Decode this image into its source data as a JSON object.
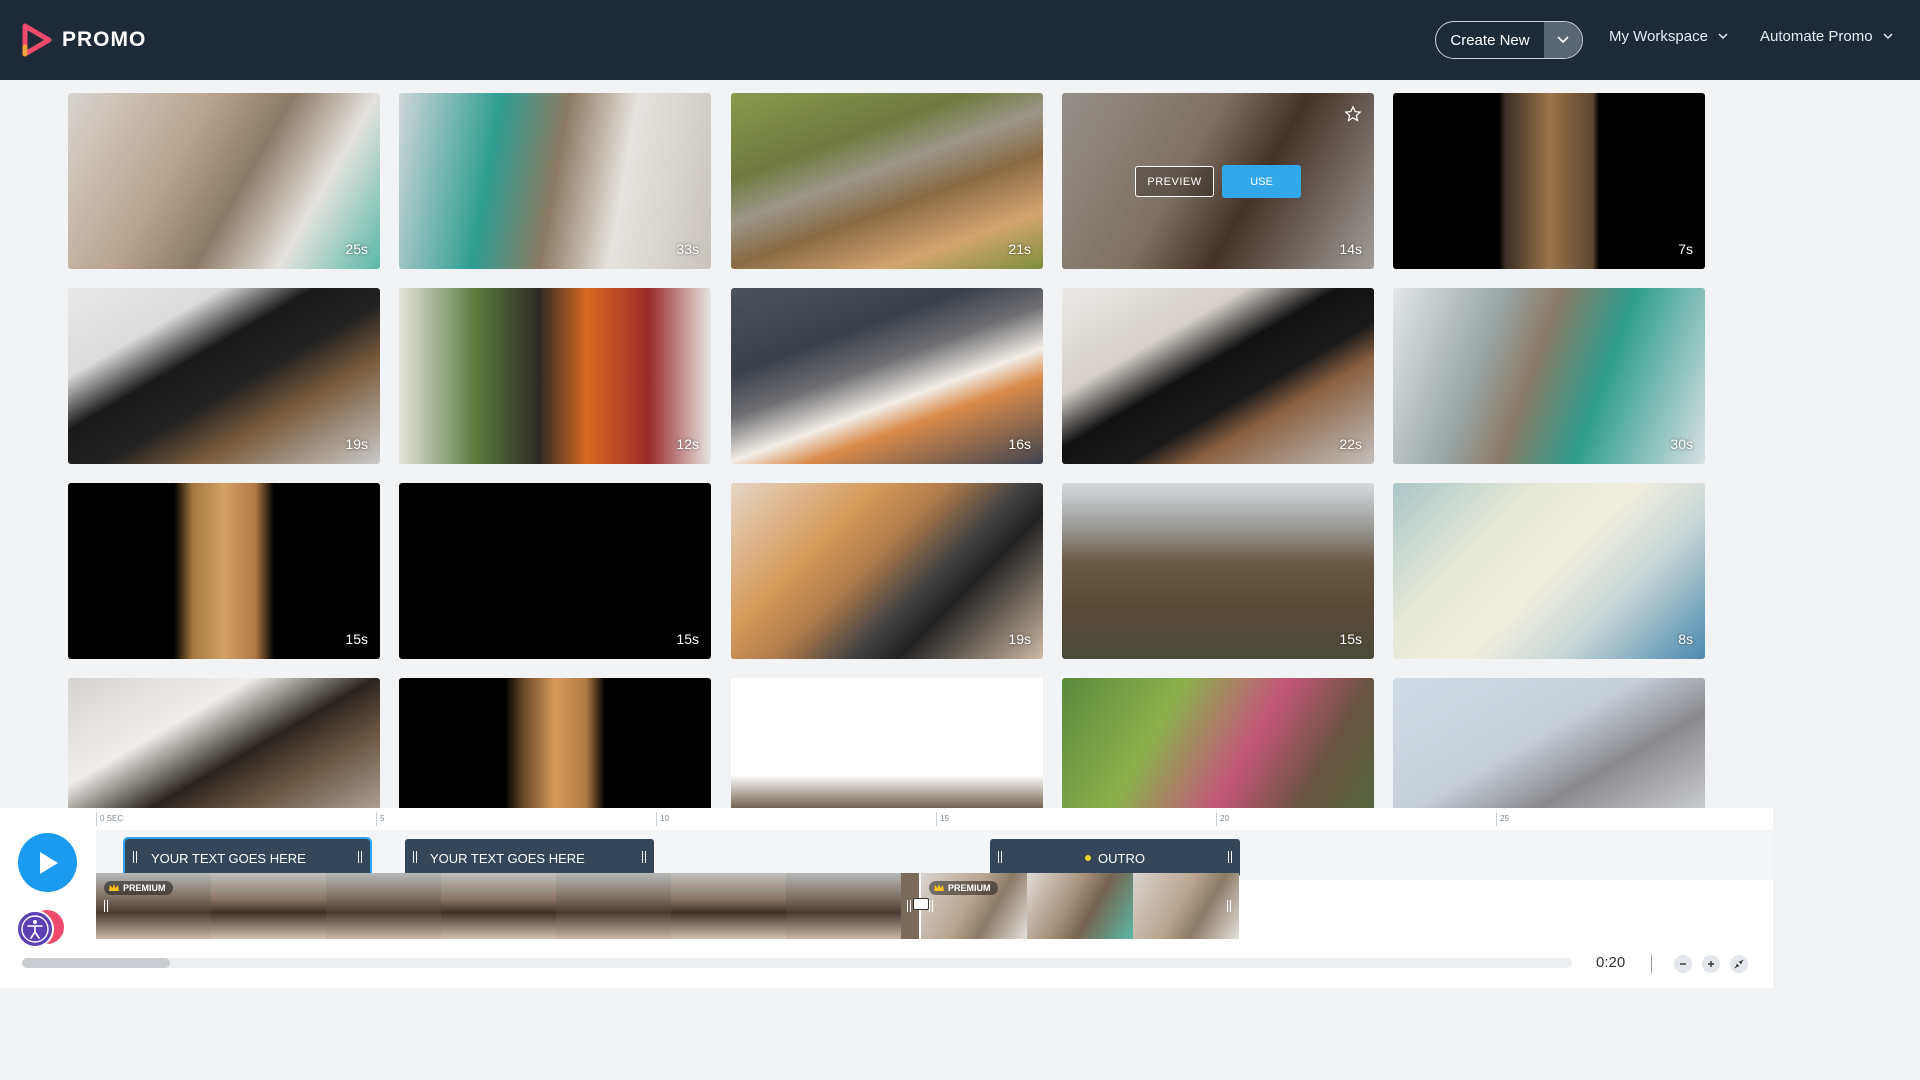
{
  "header": {
    "logo_text": "PROMO",
    "create_new_label": "Create New",
    "nav": [
      "My Workspace",
      "Automate Promo"
    ]
  },
  "colors": {
    "header_bg": "#1e2a38",
    "accent": "#1a9bf0",
    "use_button": "#32a8ea",
    "logo_accent": "#f04a6d"
  },
  "grid": {
    "preview_label": "PREVIEW",
    "use_label": "USE",
    "thumbnails": [
      {
        "duration": "25s",
        "bg": "linear-gradient(120deg,#d8d4d0 0%,#b9a48e 35%,#8b7a66 55%,#e5e2de 75%,#59b8a6 100%)"
      },
      {
        "duration": "33s",
        "bg": "linear-gradient(100deg,#cfd6d8 0%,#2e9e92 30%,#8d7a62 50%,#e6e3df 70%,#c9c3bc 100%)"
      },
      {
        "duration": "21s",
        "bg": "linear-gradient(160deg,#8a9a4c 0%,#6f7a3e 30%,#9b9687 45%,#8a6a44 60%,#d2a56e 80%,#7c8f3c 100%)"
      },
      {
        "duration": "14s",
        "bg": "linear-gradient(120deg,#c8c0b8 0%,#a89684 40%,#5a4436 60%,#d8d2cc 100%)"
      },
      {
        "duration": "7s",
        "bg": "linear-gradient(90deg,#000 0%,#000 34%,#3a2e24 36%,#9a7448 50%,#5c4632 64%,#000 66%,#000 100%)"
      },
      {
        "duration": "19s",
        "bg": "linear-gradient(150deg,#e8e8e8 0%,#dcdcdc 25%,#1a1a1a 40%,#222 55%,#7a5a3a 70%,#c9c9c9 100%)"
      },
      {
        "duration": "12s",
        "bg": "linear-gradient(90deg,#e6e4dc 0%,#5a7a3c 25%,#2e2a26 45%,#d86a20 60%,#9a2a2a 80%,#e6e6e2 100%)"
      },
      {
        "duration": "16s",
        "bg": "linear-gradient(160deg,#4b525c 0%,#3a404a 30%,#6e6e72 45%,#f2ede6 60%,#d98a4a 70%,#3e4450 100%)"
      },
      {
        "duration": "22s",
        "bg": "linear-gradient(150deg,#ece9e6 0%,#d6d0ca 30%,#111 45%,#1a1a1a 60%,#8a6040 70%,#c4c0bc 100%)"
      },
      {
        "duration": "30s",
        "bg": "linear-gradient(110deg,#e2e6e8 0%,#9aa6a6 30%,#8a7a66 45%,#2e9e8e 65%,#d8e0e2 100%)"
      },
      {
        "duration": "15s",
        "bg": "linear-gradient(90deg,#000 0%,#000 34%,#a6783e 40%,#d4a066 50%,#b07a44 60%,#000 66%,#000 100%)"
      },
      {
        "duration": "15s",
        "bg": "#000000"
      },
      {
        "duration": "19s",
        "bg": "linear-gradient(135deg,#e6d6c6 0%,#d69a5a 30%,#b07a4a 45%,#444 60%,#222 70%,#cdb9a4 100%)"
      },
      {
        "duration": "15s",
        "bg": "linear-gradient(180deg,#d6dae0 0%,#9a9a96 25%,#6a5a44 45%,#5a4a36 70%,#4a4a3a 100%)"
      },
      {
        "duration": "8s",
        "bg": "linear-gradient(135deg,#a8c6c6 0%,#e6e8d8 30%,#f2efe0 50%,#c8d6d6 70%,#4a8ab0 100%)"
      },
      {
        "duration": "",
        "bg": "linear-gradient(150deg,#d6d4d0 0%,#f0eeea 30%,#2a2420 50%,#6a5440 65%,#cfc9c2 100%)"
      },
      {
        "duration": "",
        "bg": "linear-gradient(90deg,#000 0%,#000 34%,#6a4a2a 40%,#d89a5a 50%,#b07a44 60%,#000 66%,#000 100%)"
      },
      {
        "duration": "",
        "bg": "linear-gradient(180deg,#ffffff 0%,#ffffff 55%,#6a5a46 75%,#3a2e22 100%)"
      },
      {
        "duration": "",
        "bg": "linear-gradient(120deg,#5a8a3c 0%,#8ab04c 30%,#c4567a 55%,#6a5440 75%,#4a6a3a 100%)"
      },
      {
        "duration": "",
        "bg": "linear-gradient(150deg,#d2dce6 0%,#c6ced8 40%,#8a8a8e 60%,#e8eaee 100%)"
      }
    ]
  },
  "timeline": {
    "ruler": [
      "0 SEC",
      "5",
      "10",
      "15",
      "20",
      "25"
    ],
    "text_clips": [
      "YOUR TEXT GOES HERE",
      "YOUR TEXT GOES HERE",
      "OUTRO"
    ],
    "premium_label": "PREMIUM",
    "time": "0:20",
    "scroll_position": 0.09
  }
}
